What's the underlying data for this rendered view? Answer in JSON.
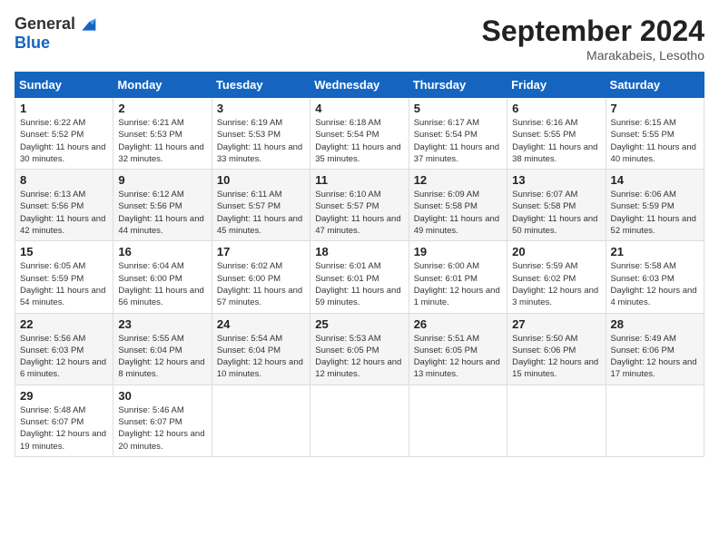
{
  "header": {
    "logo_general": "General",
    "logo_blue": "Blue",
    "month_title": "September 2024",
    "subtitle": "Marakabeis, Lesotho"
  },
  "days_of_week": [
    "Sunday",
    "Monday",
    "Tuesday",
    "Wednesday",
    "Thursday",
    "Friday",
    "Saturday"
  ],
  "weeks": [
    [
      {
        "day": "1",
        "sunrise": "6:22 AM",
        "sunset": "5:52 PM",
        "daylight": "11 hours and 30 minutes."
      },
      {
        "day": "2",
        "sunrise": "6:21 AM",
        "sunset": "5:53 PM",
        "daylight": "11 hours and 32 minutes."
      },
      {
        "day": "3",
        "sunrise": "6:19 AM",
        "sunset": "5:53 PM",
        "daylight": "11 hours and 33 minutes."
      },
      {
        "day": "4",
        "sunrise": "6:18 AM",
        "sunset": "5:54 PM",
        "daylight": "11 hours and 35 minutes."
      },
      {
        "day": "5",
        "sunrise": "6:17 AM",
        "sunset": "5:54 PM",
        "daylight": "11 hours and 37 minutes."
      },
      {
        "day": "6",
        "sunrise": "6:16 AM",
        "sunset": "5:55 PM",
        "daylight": "11 hours and 38 minutes."
      },
      {
        "day": "7",
        "sunrise": "6:15 AM",
        "sunset": "5:55 PM",
        "daylight": "11 hours and 40 minutes."
      }
    ],
    [
      {
        "day": "8",
        "sunrise": "6:13 AM",
        "sunset": "5:56 PM",
        "daylight": "11 hours and 42 minutes."
      },
      {
        "day": "9",
        "sunrise": "6:12 AM",
        "sunset": "5:56 PM",
        "daylight": "11 hours and 44 minutes."
      },
      {
        "day": "10",
        "sunrise": "6:11 AM",
        "sunset": "5:57 PM",
        "daylight": "11 hours and 45 minutes."
      },
      {
        "day": "11",
        "sunrise": "6:10 AM",
        "sunset": "5:57 PM",
        "daylight": "11 hours and 47 minutes."
      },
      {
        "day": "12",
        "sunrise": "6:09 AM",
        "sunset": "5:58 PM",
        "daylight": "11 hours and 49 minutes."
      },
      {
        "day": "13",
        "sunrise": "6:07 AM",
        "sunset": "5:58 PM",
        "daylight": "11 hours and 50 minutes."
      },
      {
        "day": "14",
        "sunrise": "6:06 AM",
        "sunset": "5:59 PM",
        "daylight": "11 hours and 52 minutes."
      }
    ],
    [
      {
        "day": "15",
        "sunrise": "6:05 AM",
        "sunset": "5:59 PM",
        "daylight": "11 hours and 54 minutes."
      },
      {
        "day": "16",
        "sunrise": "6:04 AM",
        "sunset": "6:00 PM",
        "daylight": "11 hours and 56 minutes."
      },
      {
        "day": "17",
        "sunrise": "6:02 AM",
        "sunset": "6:00 PM",
        "daylight": "11 hours and 57 minutes."
      },
      {
        "day": "18",
        "sunrise": "6:01 AM",
        "sunset": "6:01 PM",
        "daylight": "11 hours and 59 minutes."
      },
      {
        "day": "19",
        "sunrise": "6:00 AM",
        "sunset": "6:01 PM",
        "daylight": "12 hours and 1 minute."
      },
      {
        "day": "20",
        "sunrise": "5:59 AM",
        "sunset": "6:02 PM",
        "daylight": "12 hours and 3 minutes."
      },
      {
        "day": "21",
        "sunrise": "5:58 AM",
        "sunset": "6:03 PM",
        "daylight": "12 hours and 4 minutes."
      }
    ],
    [
      {
        "day": "22",
        "sunrise": "5:56 AM",
        "sunset": "6:03 PM",
        "daylight": "12 hours and 6 minutes."
      },
      {
        "day": "23",
        "sunrise": "5:55 AM",
        "sunset": "6:04 PM",
        "daylight": "12 hours and 8 minutes."
      },
      {
        "day": "24",
        "sunrise": "5:54 AM",
        "sunset": "6:04 PM",
        "daylight": "12 hours and 10 minutes."
      },
      {
        "day": "25",
        "sunrise": "5:53 AM",
        "sunset": "6:05 PM",
        "daylight": "12 hours and 12 minutes."
      },
      {
        "day": "26",
        "sunrise": "5:51 AM",
        "sunset": "6:05 PM",
        "daylight": "12 hours and 13 minutes."
      },
      {
        "day": "27",
        "sunrise": "5:50 AM",
        "sunset": "6:06 PM",
        "daylight": "12 hours and 15 minutes."
      },
      {
        "day": "28",
        "sunrise": "5:49 AM",
        "sunset": "6:06 PM",
        "daylight": "12 hours and 17 minutes."
      }
    ],
    [
      {
        "day": "29",
        "sunrise": "5:48 AM",
        "sunset": "6:07 PM",
        "daylight": "12 hours and 19 minutes."
      },
      {
        "day": "30",
        "sunrise": "5:46 AM",
        "sunset": "6:07 PM",
        "daylight": "12 hours and 20 minutes."
      },
      null,
      null,
      null,
      null,
      null
    ]
  ]
}
